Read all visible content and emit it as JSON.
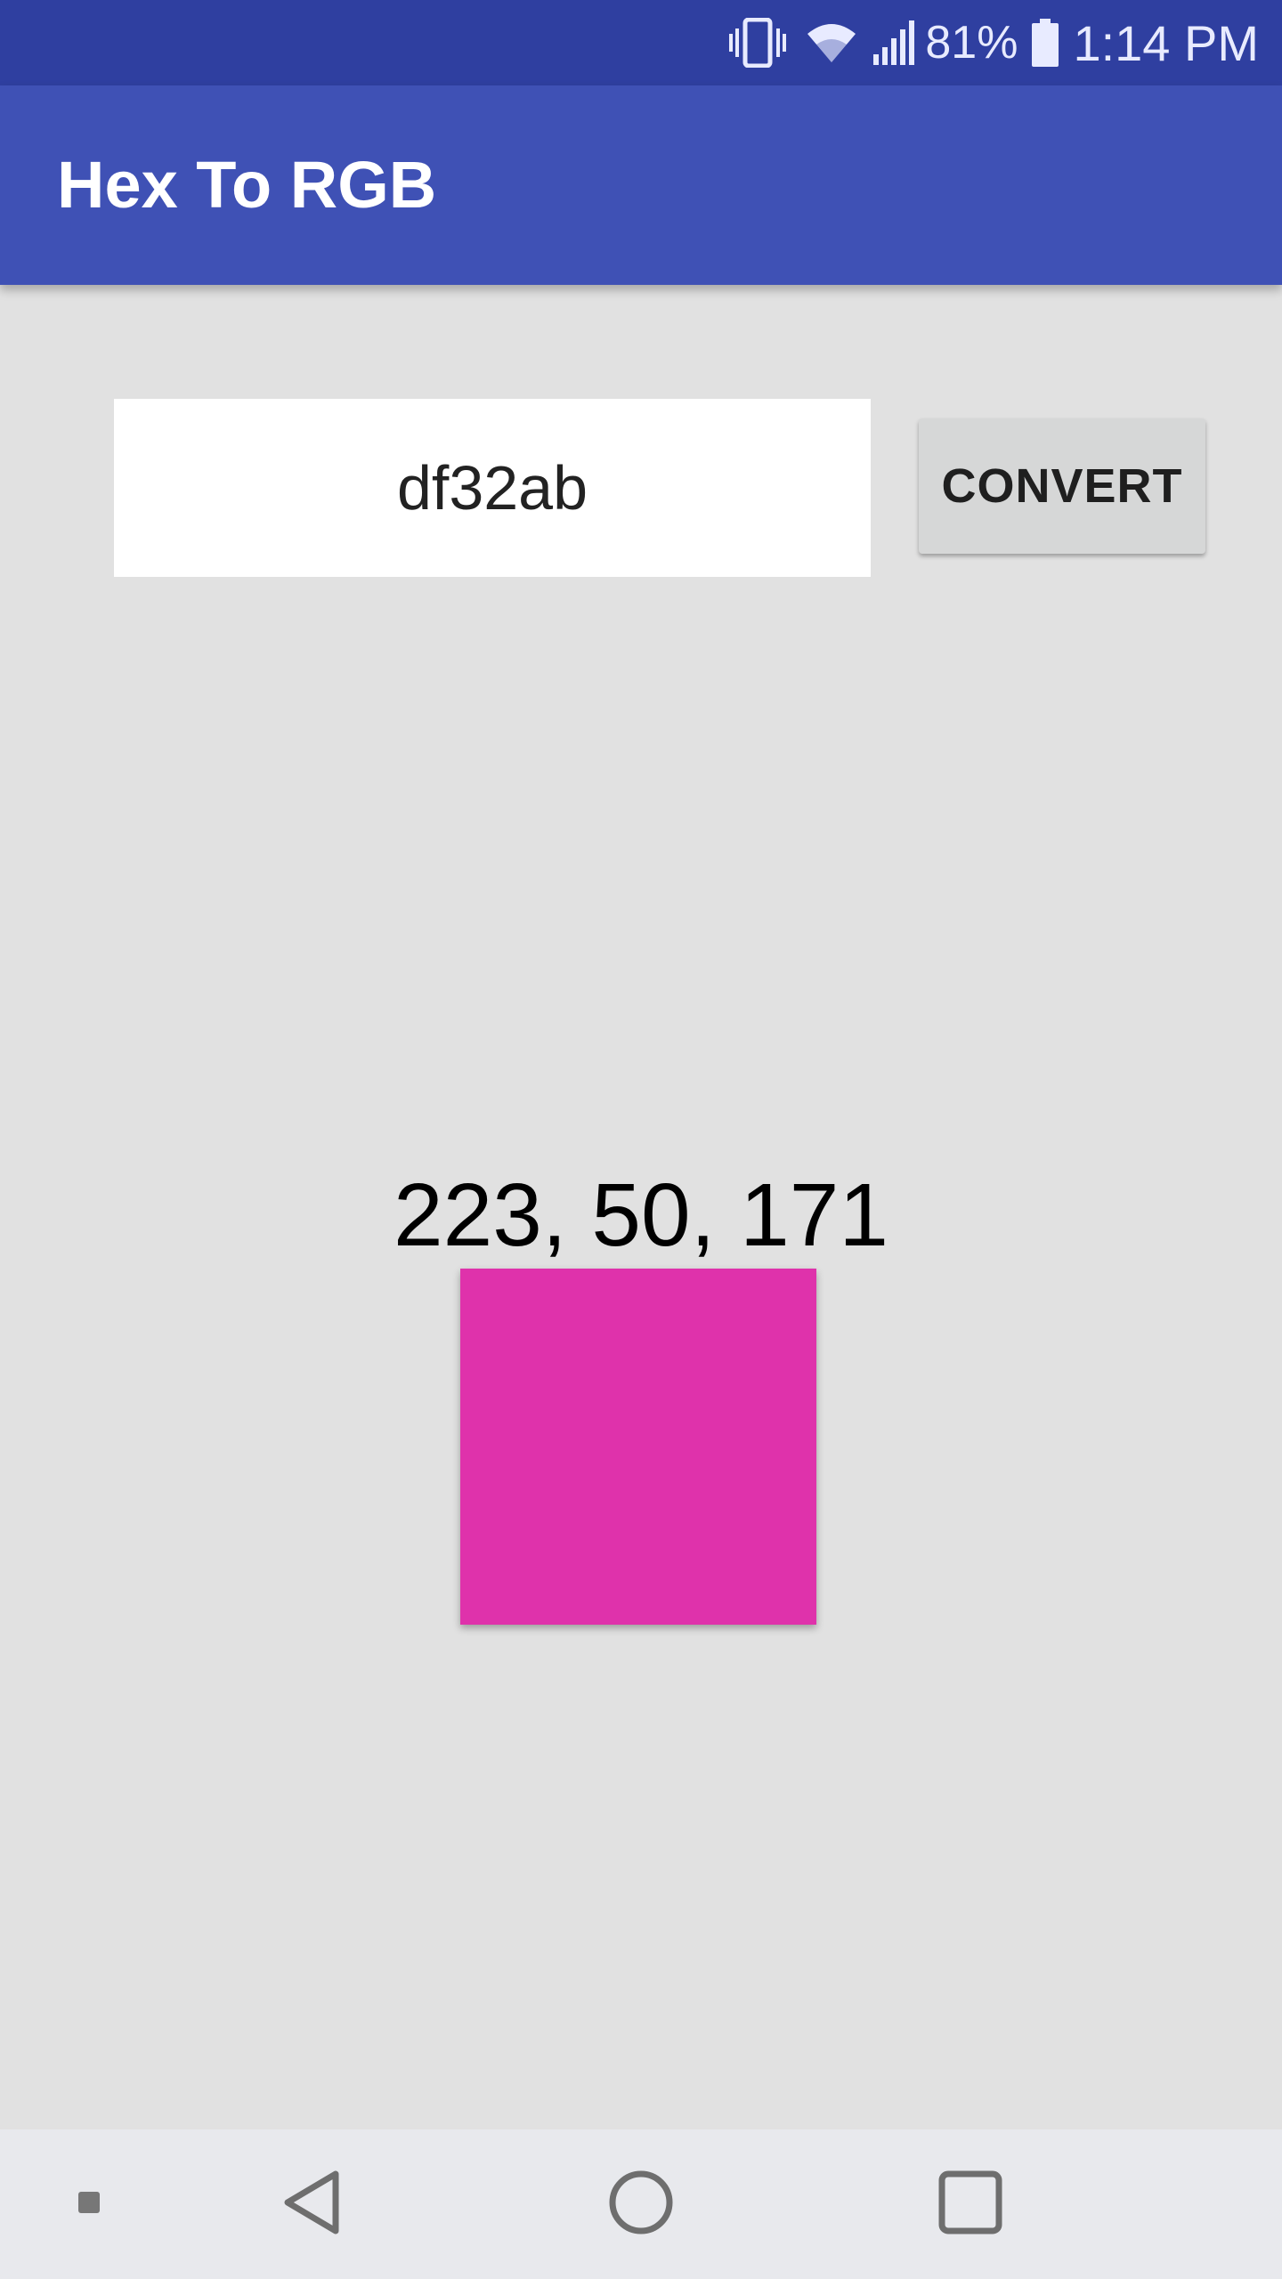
{
  "status_bar": {
    "battery_percent": "81%",
    "time": "1:14 PM",
    "icons": [
      "vibrate-icon",
      "wifi-icon",
      "signal-icon",
      "battery-icon"
    ]
  },
  "app_bar": {
    "title": "Hex To RGB"
  },
  "converter": {
    "hex_value": "df32ab",
    "convert_label": "CONVERT",
    "rgb_result": "223, 50, 171",
    "swatch_color": "#df32ab"
  },
  "nav_bar": {
    "icons": [
      "menu-dot-icon",
      "back-icon",
      "home-icon",
      "recents-icon"
    ]
  },
  "colors": {
    "status_bar": "#2f3fa0",
    "app_bar": "#3f51b5",
    "background": "#e1e1e1",
    "nav_bar": "#e8e9ed"
  }
}
